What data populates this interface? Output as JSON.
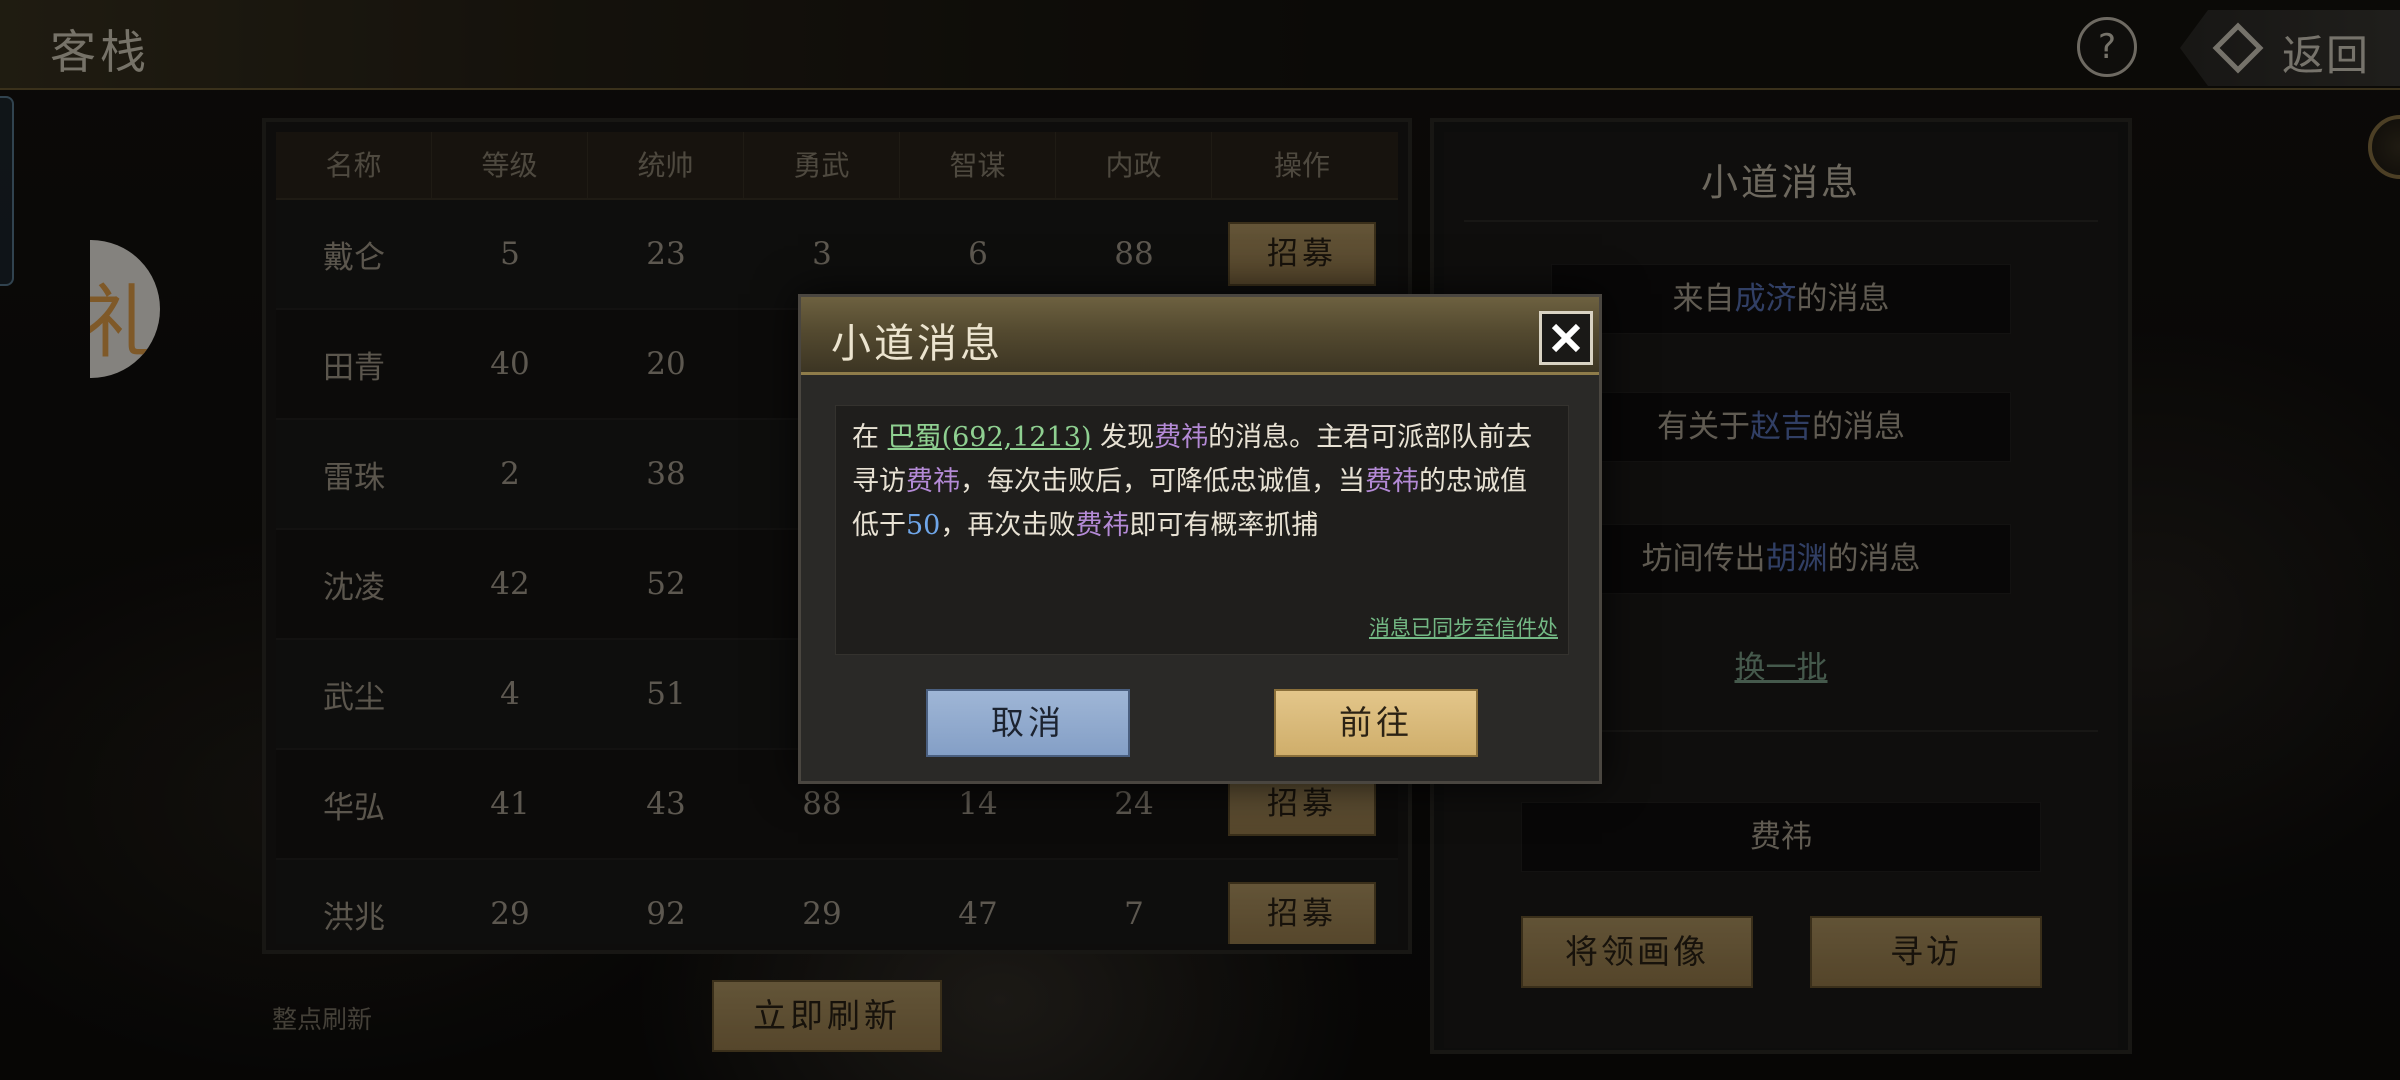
{
  "header": {
    "title": "客栈",
    "help_label": "?",
    "back_label": "返回"
  },
  "table": {
    "columns": [
      "名称",
      "等级",
      "统帅",
      "勇武",
      "智谋",
      "内政",
      "操作"
    ],
    "recruit_label": "招募",
    "rows": [
      {
        "name": "戴仑",
        "level": "5",
        "command": "23",
        "valor": "3",
        "wisdom": "6",
        "politics": "88"
      },
      {
        "name": "田青",
        "level": "40",
        "command": "20",
        "valor": "",
        "wisdom": "",
        "politics": ""
      },
      {
        "name": "雷珠",
        "level": "2",
        "command": "38",
        "valor": "",
        "wisdom": "",
        "politics": ""
      },
      {
        "name": "沈凌",
        "level": "42",
        "command": "52",
        "valor": "",
        "wisdom": "",
        "politics": ""
      },
      {
        "name": "武尘",
        "level": "4",
        "command": "51",
        "valor": "",
        "wisdom": "",
        "politics": ""
      },
      {
        "name": "华弘",
        "level": "41",
        "command": "43",
        "valor": "88",
        "wisdom": "14",
        "politics": "24"
      },
      {
        "name": "洪兆",
        "level": "29",
        "command": "92",
        "valor": "29",
        "wisdom": "47",
        "politics": "7"
      }
    ]
  },
  "footer": {
    "refresh_note": "整点刷新",
    "refresh_button": "立即刷新"
  },
  "side_panel": {
    "title": "小道消息",
    "messages": [
      {
        "prefix": "来自",
        "name": "成济",
        "suffix": "的消息"
      },
      {
        "prefix": "有关于",
        "name": "赵吉",
        "suffix": "的消息"
      },
      {
        "prefix": "坊间传出",
        "name": "胡渊",
        "suffix": "的消息"
      }
    ],
    "swap_label": "换一批",
    "target_name": "费祎",
    "portrait_button": "将领画像",
    "visit_button": "寻访"
  },
  "modal": {
    "title": "小道消息",
    "text": {
      "t1": "在 ",
      "location": "巴蜀(692,1213)",
      "t2": " 发现",
      "name": "费祎",
      "t3": "的消息。主君可派部队前去寻访",
      "t4": "，每次击败后，可降低忠诚值，当",
      "t5": "的忠诚值低于",
      "threshold": "50",
      "t6": "，再次击败",
      "t7": "即可有概率抓捕"
    },
    "sync_note": "消息已同步至信件处",
    "cancel_label": "取消",
    "go_label": "前往"
  },
  "colors": {
    "accent_gold": "#cfae6b",
    "cancel_blue": "#849fc6",
    "location_green": "#8fd091",
    "name_purple": "#b48ad6",
    "value_blue": "#6fa6e8"
  }
}
